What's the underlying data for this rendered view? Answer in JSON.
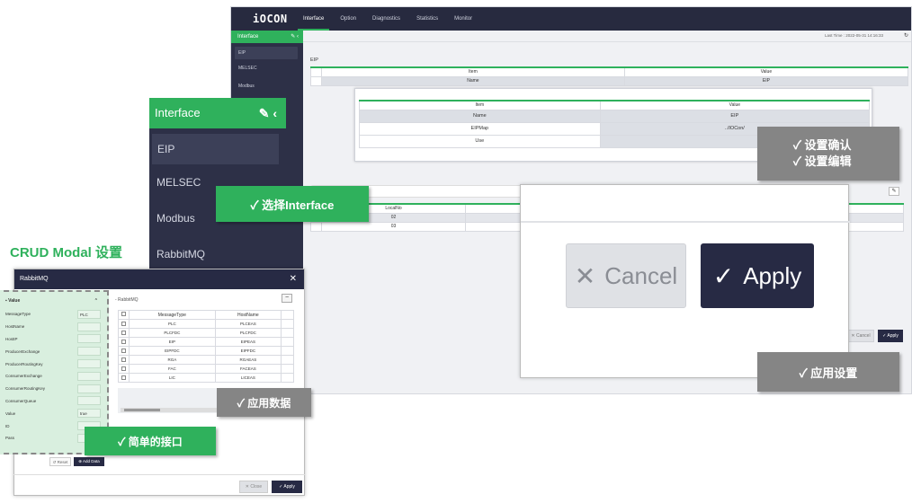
{
  "main_window": {
    "logo": "iOCON",
    "nav": [
      "Interface",
      "Option",
      "Diagnostics",
      "Statistics",
      "Monitor"
    ],
    "sidebar": {
      "title": "Interface",
      "items": [
        "EIP",
        "MELSEC",
        "Modbus"
      ]
    },
    "last_time": "Last Time : 2022-05-31 14:16:33",
    "section": "EIP",
    "table": {
      "headers": [
        "Item",
        "Value"
      ],
      "rows": [
        [
          "Name",
          "EIP"
        ]
      ]
    }
  },
  "interface_panel": {
    "title": "Interface",
    "items": [
      "EIP",
      "MELSEC",
      "Modbus",
      "RabbitMQ"
    ]
  },
  "eip_zoom": {
    "headers": [
      "Item",
      "Value"
    ],
    "rows": [
      [
        "Name",
        "EIP"
      ],
      [
        "EIPMap",
        "../IOCon/"
      ],
      [
        "Use",
        ""
      ]
    ]
  },
  "local_table": {
    "header": "LocalNo",
    "rows": [
      "02",
      "03"
    ]
  },
  "buttons": {
    "cancel": "Cancel",
    "apply": "Apply",
    "close": "Close",
    "reset": "Reset",
    "add_data": "Add Data"
  },
  "callouts": {
    "select_interface": "✓ 选择Interface",
    "confirm_line1": "✓ 设置确认",
    "confirm_line2": "✓ 设置编辑",
    "apply_data": "✓ 应用数据",
    "apply_settings": "✓ 应用设置",
    "simple_interface": "✓ 简单的接口",
    "crud_title": "CRUD Modal 设置"
  },
  "modal": {
    "title": "RabbitMQ",
    "value_header": "Value",
    "fields": [
      {
        "label": "MessageType",
        "value": "PLC"
      },
      {
        "label": "HostName",
        "value": ""
      },
      {
        "label": "HostIP",
        "value": ""
      },
      {
        "label": "ProducerExchange",
        "value": ""
      },
      {
        "label": "ProducerRoutingKey",
        "value": ""
      },
      {
        "label": "ConsumerExchange",
        "value": ""
      },
      {
        "label": "ConsumerRoutingKey",
        "value": ""
      },
      {
        "label": "ConsumerQueue",
        "value": ""
      },
      {
        "label": "Value",
        "value": "true"
      },
      {
        "label": "ID",
        "value": ""
      },
      {
        "label": "Pass",
        "value": ""
      }
    ],
    "list_title": "- RabbitMQ",
    "list_headers": [
      "MessageType",
      "HostName"
    ],
    "list_rows": [
      [
        "PLC",
        "PLCEAS"
      ],
      [
        "PLCFDC",
        "PLCFDC"
      ],
      [
        "EIP",
        "EIPEAS"
      ],
      [
        "EIPFDC",
        "EIPFDC"
      ],
      [
        "RGA",
        "RGAEAS"
      ],
      [
        "FAC",
        "FACEAS"
      ],
      [
        "LIC",
        "LICEAS"
      ]
    ]
  },
  "colors": {
    "accent": "#2fb15c",
    "dark": "#272a44",
    "callout_grey": "#858585"
  }
}
